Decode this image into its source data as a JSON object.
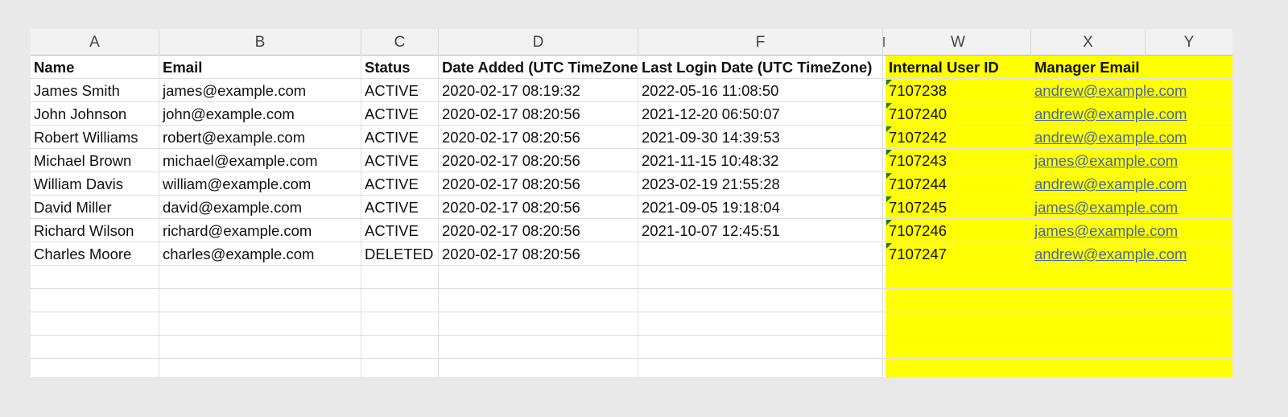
{
  "columns": [
    "A",
    "B",
    "C",
    "D",
    "F",
    "W",
    "X",
    "Y"
  ],
  "headers": {
    "name": "Name",
    "email": "Email",
    "status": "Status",
    "date_added": "Date Added (UTC TimeZone)",
    "last_login": "Last Login Date (UTC TimeZone)",
    "internal_id": "Internal User ID",
    "manager_email": "Manager Email"
  },
  "rows": [
    {
      "name": "James Smith",
      "email": "james@example.com",
      "status": "ACTIVE",
      "date_added": "2020-02-17 08:19:32",
      "last_login": "2022-05-16 11:08:50",
      "internal_id": "7107238",
      "manager_email": "andrew@example.com"
    },
    {
      "name": "John Johnson",
      "email": "john@example.com",
      "status": "ACTIVE",
      "date_added": "2020-02-17 08:20:56",
      "last_login": "2021-12-20 06:50:07",
      "internal_id": "7107240",
      "manager_email": "andrew@example.com"
    },
    {
      "name": "Robert Williams",
      "email": "robert@example.com",
      "status": "ACTIVE",
      "date_added": "2020-02-17 08:20:56",
      "last_login": "2021-09-30 14:39:53",
      "internal_id": "7107242",
      "manager_email": "andrew@example.com"
    },
    {
      "name": "Michael Brown",
      "email": "michael@example.com",
      "status": "ACTIVE",
      "date_added": "2020-02-17 08:20:56",
      "last_login": "2021-11-15 10:48:32",
      "internal_id": "7107243",
      "manager_email": "james@example.com"
    },
    {
      "name": "William Davis",
      "email": "william@example.com",
      "status": "ACTIVE",
      "date_added": "2020-02-17 08:20:56",
      "last_login": "2023-02-19 21:55:28",
      "internal_id": "7107244",
      "manager_email": "andrew@example.com"
    },
    {
      "name": "David Miller",
      "email": "david@example.com",
      "status": "ACTIVE",
      "date_added": "2020-02-17 08:20:56",
      "last_login": "2021-09-05 19:18:04",
      "internal_id": "7107245",
      "manager_email": "james@example.com"
    },
    {
      "name": "Richard Wilson",
      "email": "richard@example.com",
      "status": "ACTIVE",
      "date_added": "2020-02-17 08:20:56",
      "last_login": "2021-10-07 12:45:51",
      "internal_id": "7107246",
      "manager_email": "james@example.com"
    },
    {
      "name": "Charles Moore",
      "email": "charles@example.com",
      "status": "DELETED",
      "date_added": "2020-02-17 08:20:56",
      "last_login": "",
      "internal_id": "7107247",
      "manager_email": "andrew@example.com"
    }
  ],
  "colors": {
    "highlight": "#ffff00",
    "link": "#4a6a93",
    "number_as_text_indicator": "#1a7a2c"
  }
}
